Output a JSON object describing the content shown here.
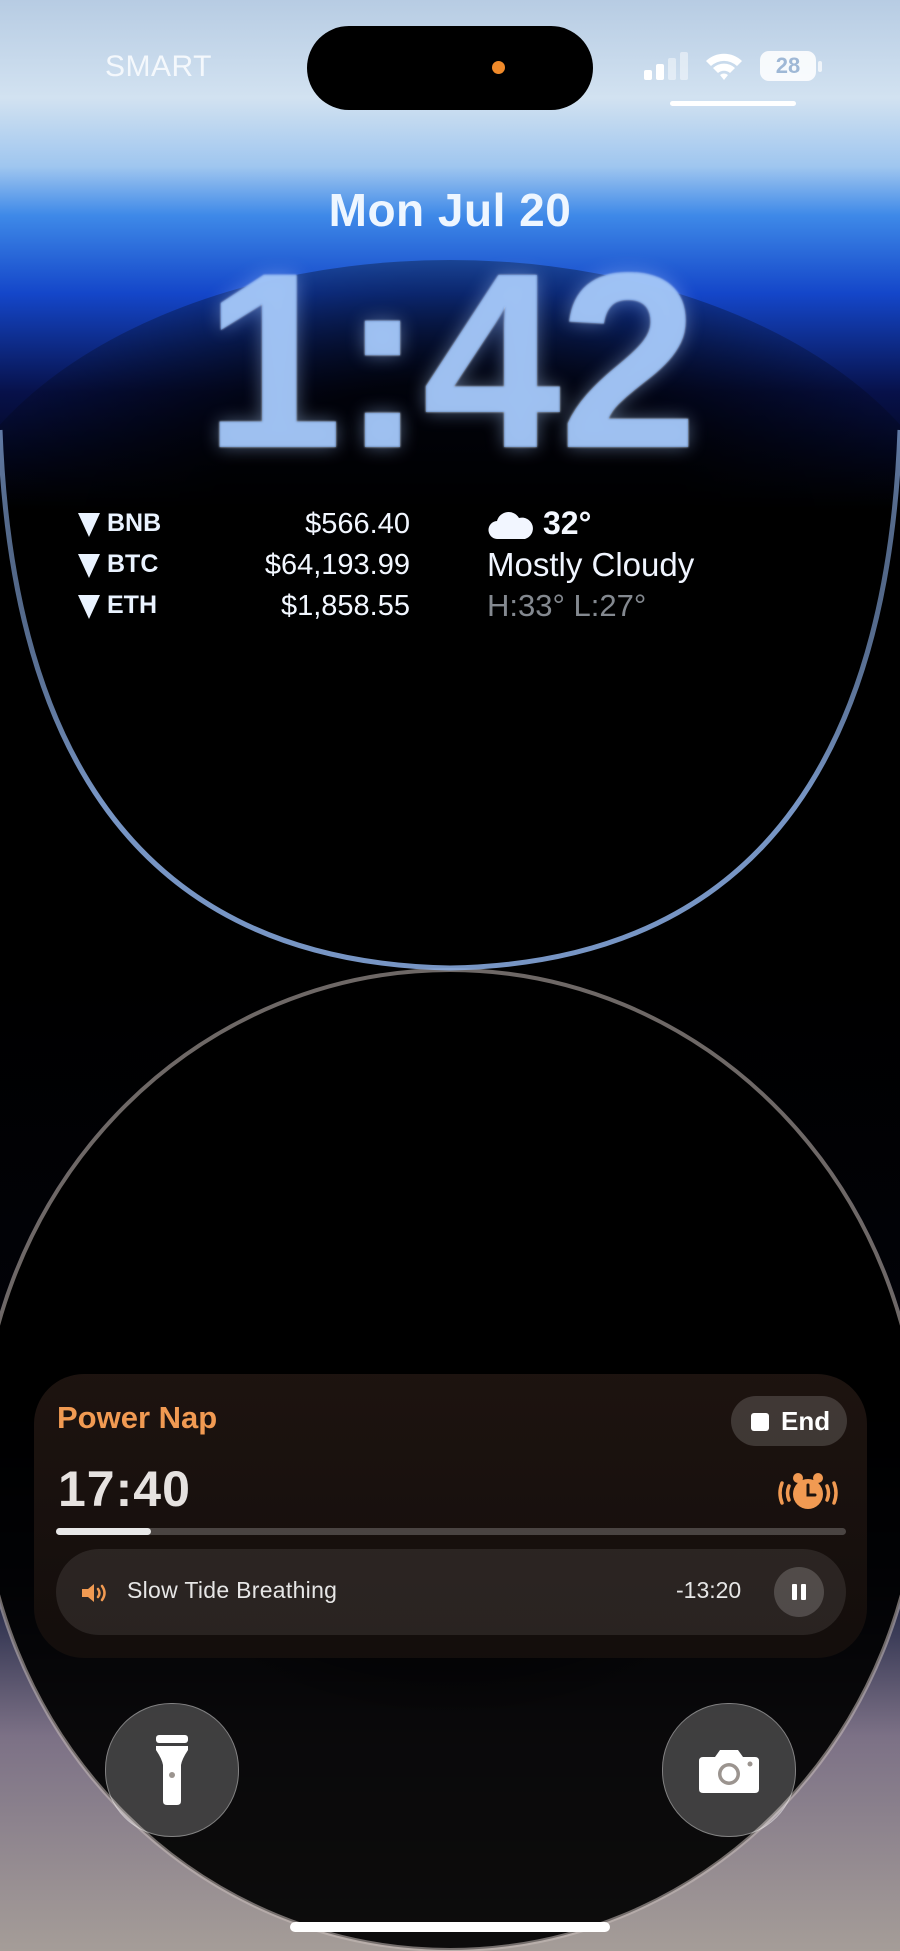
{
  "status_bar": {
    "carrier": "SMART",
    "battery_level": "28",
    "icons": [
      "signal-icon",
      "wifi-icon",
      "battery-icon"
    ]
  },
  "lock_screen": {
    "date": "Mon Jul 20",
    "time": "1:42"
  },
  "crypto_widget": {
    "items": [
      {
        "symbol": "BNB",
        "price": "$566.40",
        "trend": "down"
      },
      {
        "symbol": "BTC",
        "price": "$64,193.99",
        "trend": "down"
      },
      {
        "symbol": "ETH",
        "price": "$1,858.55",
        "trend": "down"
      }
    ]
  },
  "weather_widget": {
    "icon": "cloud-icon",
    "temperature": "32°",
    "condition": "Mostly Cloudy",
    "high_low": "H:33° L:27°"
  },
  "live_activity": {
    "title": "Power Nap",
    "end_label": "End",
    "timer": "17:40",
    "progress": 0.12,
    "track_name": "Slow Tide Breathing",
    "remaining": "-13:20",
    "accent_color": "#f19a52"
  },
  "quick_actions": {
    "left": "flashlight-icon",
    "right": "camera-icon"
  }
}
